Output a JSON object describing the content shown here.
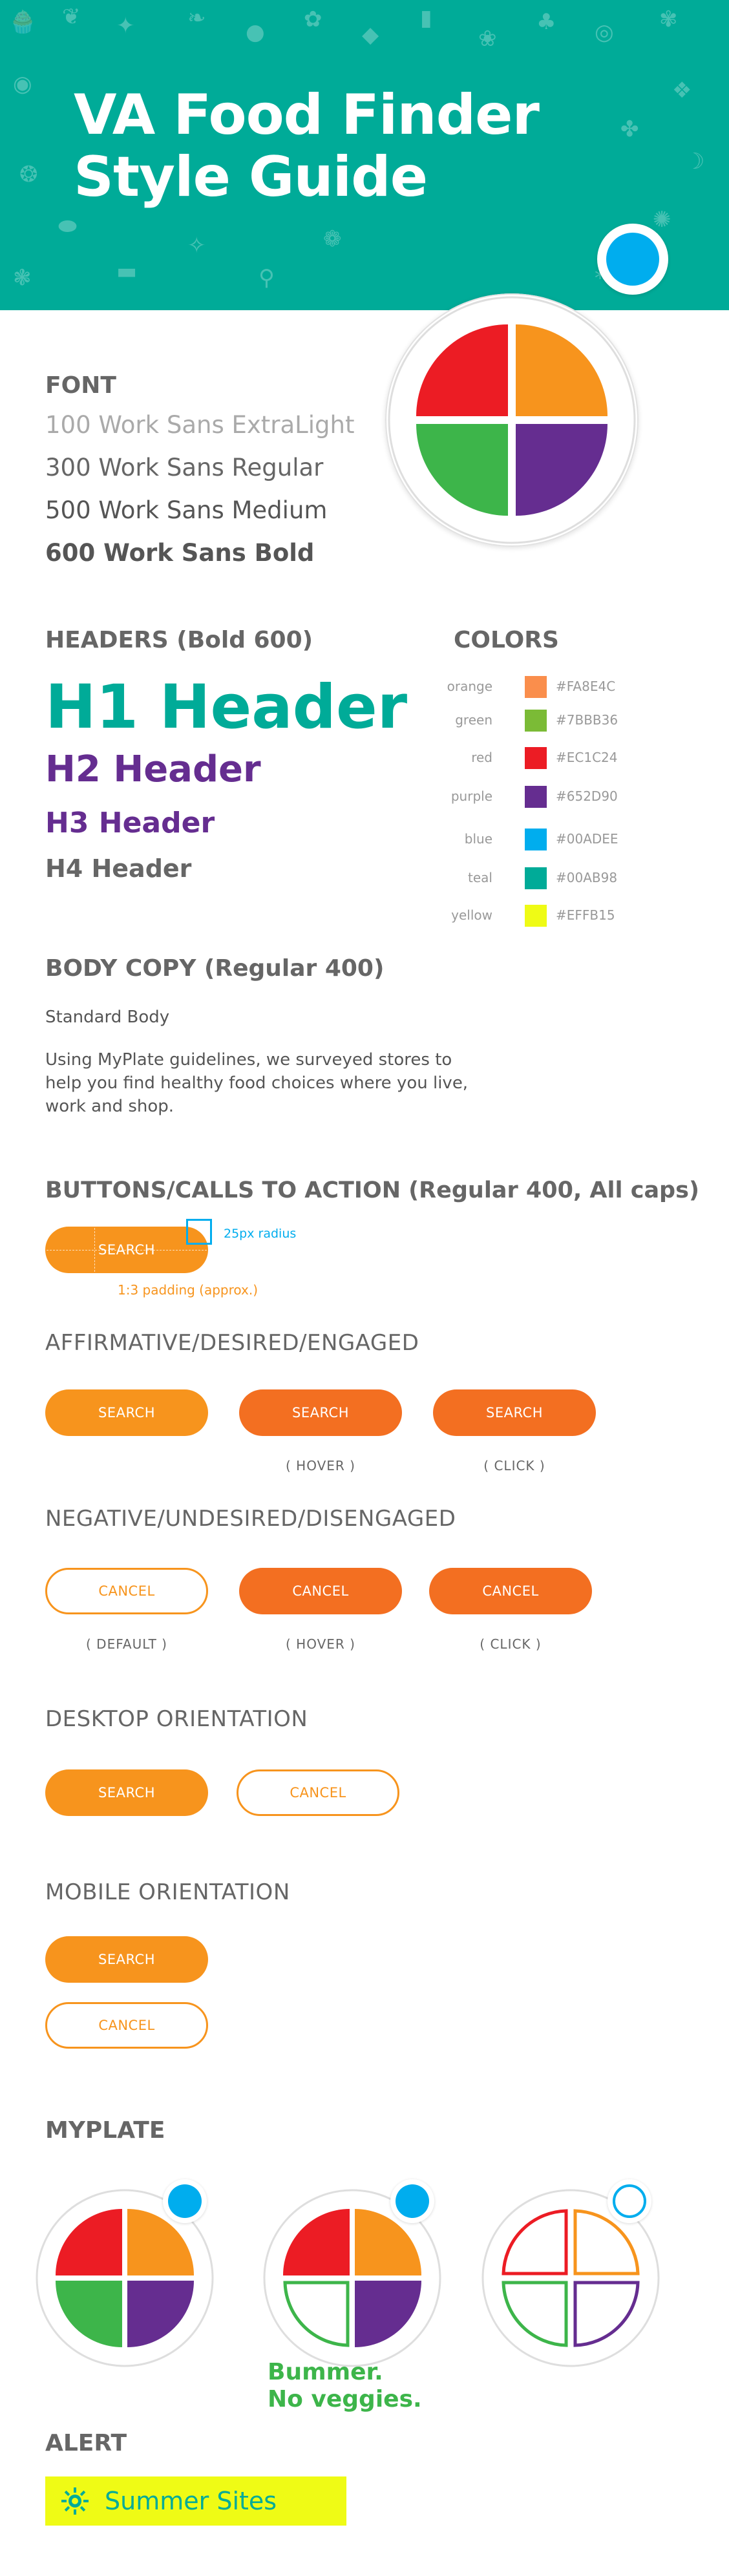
{
  "banner": {
    "title_line1": "VA Food Finder",
    "title_line2": "Style Guide",
    "color": "#00AB98"
  },
  "font": {
    "title": "FONT",
    "samples": [
      "100 Work Sans ExtraLight",
      "300 Work Sans Regular",
      "500 Work Sans Medium",
      "600 Work Sans Bold"
    ]
  },
  "headers": {
    "title": "HEADERS (Bold 600)",
    "h1": "H1 Header",
    "h2": "H2 Header",
    "h3": "H3 Header",
    "h4": "H4 Header"
  },
  "colors": {
    "title": "COLORS",
    "items": [
      {
        "name": "orange",
        "hex": "#FA8E4C"
      },
      {
        "name": "green",
        "hex": "#7BBB36"
      },
      {
        "name": "red",
        "hex": "#EC1C24"
      },
      {
        "name": "purple",
        "hex": "#652D90"
      },
      {
        "name": "blue",
        "hex": "#00ADEE"
      },
      {
        "name": "teal",
        "hex": "#00AB98"
      },
      {
        "name": "yellow",
        "hex": "#EFFB15"
      }
    ]
  },
  "body_copy": {
    "title": "BODY COPY (Regular 400)",
    "standard": "Standard Body",
    "para_line1": "Using MyPlate guidelines, we surveyed stores to",
    "para_line2": "help you find healthy food choices where you live,",
    "para_line3": "work and shop."
  },
  "buttons": {
    "title": "BUTTONS/CALLS TO ACTION (Regular 400, All caps)",
    "demo_label": "SEARCH",
    "radius_note": "25px radius",
    "padding_note": "1:3 padding (approx.)",
    "affirmative": {
      "title": "AFFIRMATIVE/DESIRED/ENGAGED",
      "labels": [
        "SEARCH",
        "SEARCH",
        "SEARCH"
      ],
      "captions": [
        "( HOVER )",
        "( CLICK )"
      ]
    },
    "negative": {
      "title": "NEGATIVE/UNDESIRED/DISENGAGED",
      "labels": [
        "CANCEL",
        "CANCEL",
        "CANCEL"
      ],
      "captions": [
        "( DEFAULT )",
        "( HOVER )",
        "( CLICK )"
      ]
    },
    "desktop": {
      "title": "DESKTOP ORIENTATION",
      "search": "SEARCH",
      "cancel": "CANCEL"
    },
    "mobile": {
      "title": "MOBILE ORIENTATION",
      "search": "SEARCH",
      "cancel": "CANCEL"
    }
  },
  "myplate": {
    "title": "MYPLATE",
    "bummer_line1": "Bummer.",
    "bummer_line2": "No veggies."
  },
  "alert": {
    "title": "ALERT",
    "text": "Summer Sites",
    "icon": "sun-icon"
  }
}
